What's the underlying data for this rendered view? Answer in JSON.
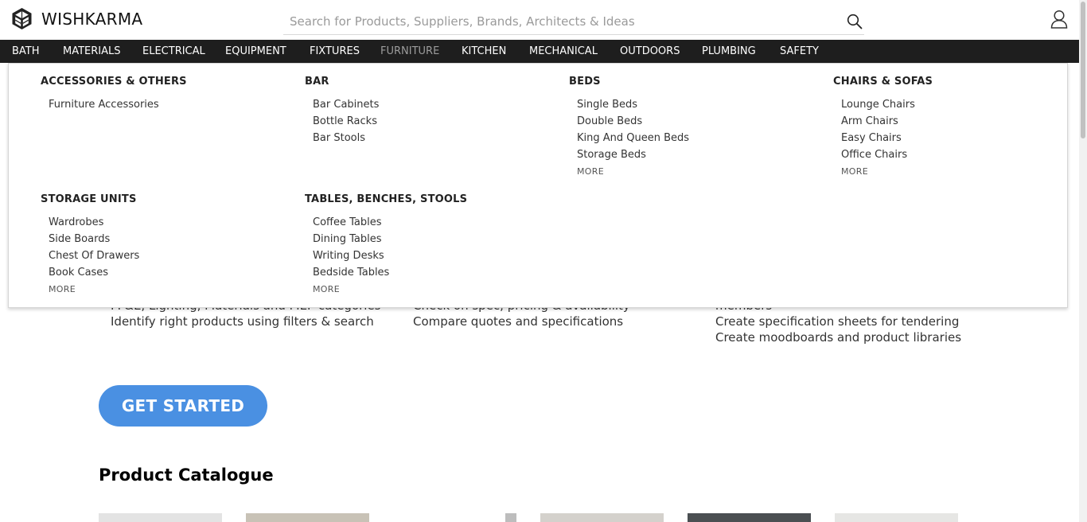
{
  "header": {
    "brand": "WISHKARMA",
    "search_placeholder": "Search for Products, Suppliers, Brands, Architects & Ideas"
  },
  "nav": {
    "items": [
      {
        "label": "BATH"
      },
      {
        "label": "MATERIALS"
      },
      {
        "label": "ELECTRICAL"
      },
      {
        "label": "EQUIPMENT"
      },
      {
        "label": "FIXTURES"
      },
      {
        "label": "FURNITURE",
        "active": true
      },
      {
        "label": "KITCHEN"
      },
      {
        "label": "MECHANICAL"
      },
      {
        "label": "OUTDOORS"
      },
      {
        "label": "PLUMBING"
      },
      {
        "label": "SAFETY"
      }
    ]
  },
  "menu": {
    "categories": [
      {
        "title": "ACCESSORIES & OTHERS",
        "items": [
          "Furniture Accessories"
        ]
      },
      {
        "title": "BAR",
        "items": [
          "Bar Cabinets",
          "Bottle Racks",
          "Bar Stools"
        ]
      },
      {
        "title": "BEDS",
        "items": [
          "Single Beds",
          "Double Beds",
          "King And Queen Beds",
          "Storage Beds"
        ],
        "more": "MORE"
      },
      {
        "title": "CHAIRS & SOFAS",
        "items": [
          "Lounge Chairs",
          "Arm Chairs",
          "Easy Chairs",
          "Office Chairs"
        ],
        "more": "MORE"
      },
      {
        "title": "STORAGE UNITS",
        "items": [
          "Wardrobes",
          "Side Boards",
          "Chest Of Drawers",
          "Book Cases"
        ],
        "more": "MORE"
      },
      {
        "title": "TABLES, BENCHES, STOOLS",
        "items": [
          "Coffee Tables",
          "Dining Tables",
          "Writing Desks",
          "Bedside Tables"
        ],
        "more": "MORE"
      }
    ]
  },
  "features": {
    "col1": [
      "FF&E, Lighting, Materials and MEP categories",
      "Identify right products using filters & search"
    ],
    "col2": [
      "Check on spec, pricing & availability",
      "Compare quotes and specifications"
    ],
    "col3": [
      "members",
      "Create specification sheets for tendering",
      "Create moodboards and product libraries"
    ]
  },
  "cta": {
    "label": "GET STARTED"
  },
  "catalogue": {
    "title": "Product Catalogue"
  },
  "colors": {
    "nav_bg": "#1e1e1e",
    "accent": "#4a90e2",
    "nav_active": "#9c9c9c"
  }
}
